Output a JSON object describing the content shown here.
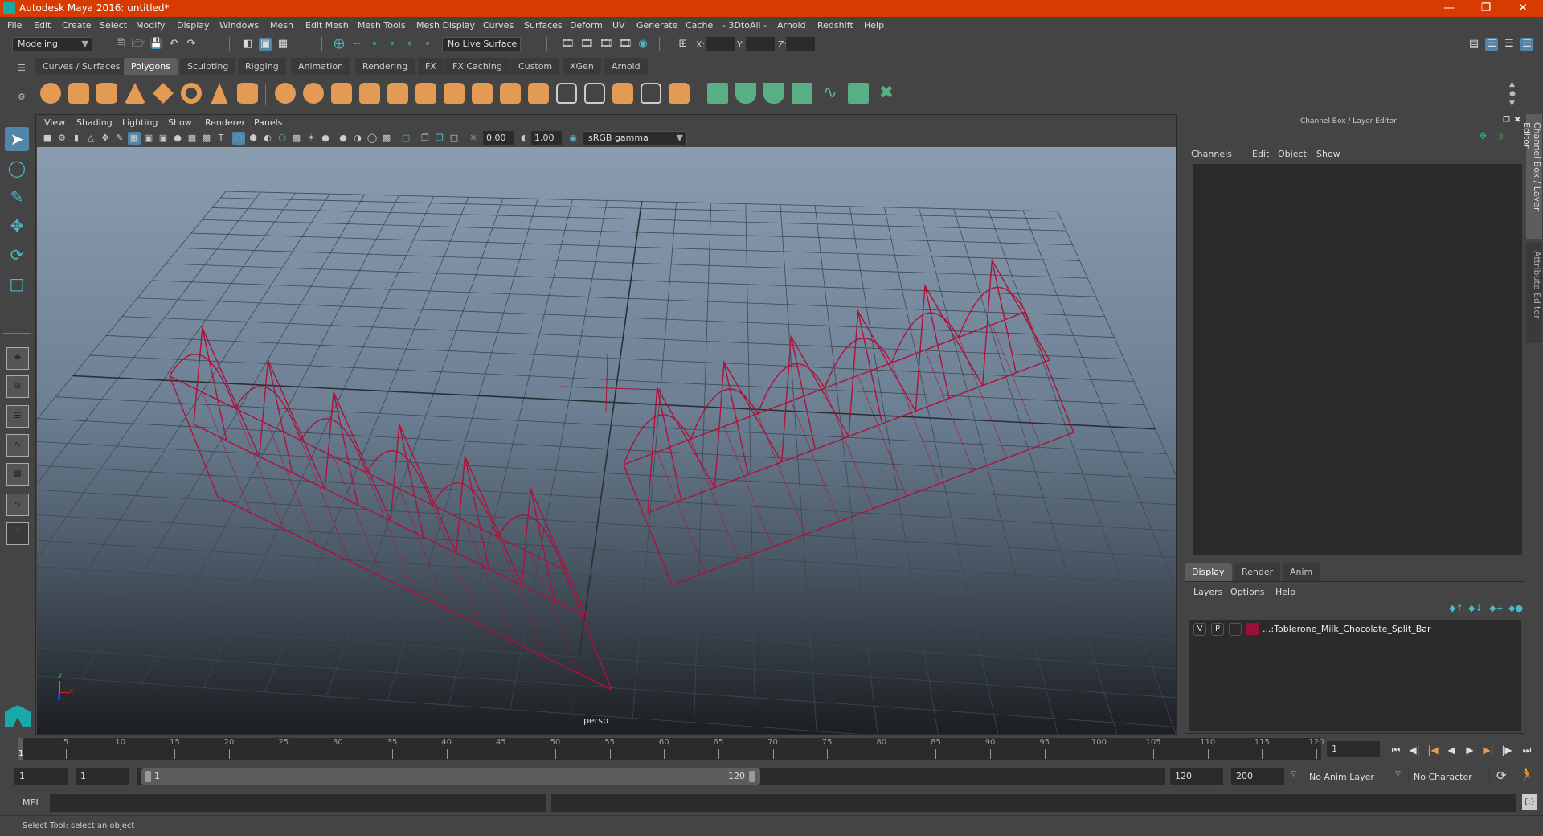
{
  "window": {
    "title": "Autodesk Maya 2016: untitled*",
    "controls": [
      "minimize",
      "restore",
      "close"
    ]
  },
  "menubar": [
    "File",
    "Edit",
    "Create",
    "Select",
    "Modify",
    "Display",
    "Windows",
    "Mesh",
    "Edit Mesh",
    "Mesh Tools",
    "Mesh Display",
    "Curves",
    "Surfaces",
    "Deform",
    "UV",
    "Generate",
    "Cache",
    "- 3DtoAll -",
    "Arnold",
    "Redshift",
    "Help"
  ],
  "statusline": {
    "mode": "Modeling",
    "live_surface": "No Live Surface",
    "x_label": "X:",
    "y_label": "Y:",
    "z_label": "Z:",
    "x_value": "",
    "y_value": "",
    "z_value": ""
  },
  "shelf": {
    "tabs": [
      "Curves / Surfaces",
      "Polygons",
      "Sculpting",
      "Rigging",
      "Animation",
      "Rendering",
      "FX",
      "FX Caching",
      "Custom",
      "XGen",
      "Arnold"
    ],
    "active_tab": "Polygons",
    "icons": [
      "poly-sphere",
      "poly-cube",
      "poly-cylinder",
      "poly-cone",
      "poly-plane",
      "poly-torus",
      "poly-pyramid",
      "poly-pipe",
      "combine",
      "separate",
      "mirror",
      "smooth",
      "extrude",
      "bevel",
      "bridge",
      "multi-cut",
      "target-weld",
      "connect",
      "append-polygon",
      "fill-hole",
      "insert-edge-loop",
      "offset-edge-loop",
      "merge",
      "uv-editor",
      "planar-map",
      "cylindrical-map",
      "spherical-map",
      "automatic-map",
      "unfold",
      "layout-uvs",
      "cut-uvs"
    ]
  },
  "tools": [
    "select-tool",
    "lasso-tool",
    "paint-select-tool",
    "move-tool",
    "rotate-tool",
    "scale-tool"
  ],
  "layout_presets": [
    "single-perspective",
    "four-view",
    "persp-outliner",
    "persp-graph",
    "hypershade-persp",
    "persp-graph-outliner",
    "custom-layout"
  ],
  "viewport": {
    "menu": [
      "View",
      "Shading",
      "Lighting",
      "Show",
      "Renderer",
      "Panels"
    ],
    "exposure": "0.00",
    "gamma": "1.00",
    "color_space": "sRGB gamma",
    "camera": "persp",
    "axis": {
      "x": "x",
      "y": "y",
      "z": "z"
    },
    "wire_color": "#b0103a"
  },
  "channel_box": {
    "title": "Channel Box / Layer Editor",
    "menu": [
      "Channels",
      "Edit",
      "Object",
      "Show"
    ]
  },
  "layer_editor": {
    "tabs": [
      "Display",
      "Render",
      "Anim"
    ],
    "active_tab": "Display",
    "menu": [
      "Layers",
      "Options",
      "Help"
    ],
    "layers": [
      {
        "visible": "V",
        "playback": "P",
        "color": "#9b0f34",
        "name": "...:Toblerone_Milk_Chocolate_Split_Bar"
      }
    ]
  },
  "side_tabs": [
    "Channel Box / Layer Editor",
    "Attribute Editor"
  ],
  "timeline": {
    "start": 1,
    "end": 120,
    "tick_labels": [
      "5",
      "10",
      "15",
      "20",
      "25",
      "30",
      "35",
      "40",
      "45",
      "50",
      "55",
      "60",
      "65",
      "70",
      "75",
      "80",
      "85",
      "90",
      "95",
      "100",
      "105",
      "110",
      "115",
      "120"
    ],
    "current_frame_marker": "1",
    "current_frame": "1"
  },
  "range": {
    "anim_start": "1",
    "playback_start": "1",
    "slider_start": "1",
    "slider_end": "120",
    "playback_end": "120",
    "anim_end": "200",
    "anim_layer": "No Anim Layer",
    "character_set": "No Character Set"
  },
  "playback": [
    "go-to-start",
    "step-back-frame",
    "step-back-key",
    "play-backward",
    "play-forward",
    "step-forward-key",
    "step-forward-frame",
    "go-to-end"
  ],
  "command_line": {
    "label": "MEL",
    "value": "",
    "result": ""
  },
  "help_line": "Select Tool: select an object"
}
